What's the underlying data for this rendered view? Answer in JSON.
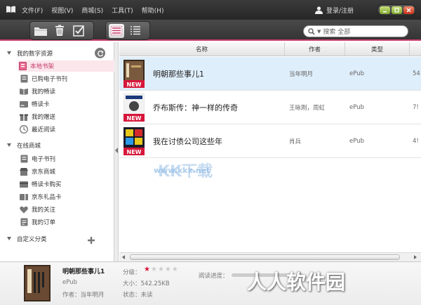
{
  "menu": [
    "文件(F)",
    "视图(V)",
    "商城(S)",
    "工具(T)",
    "帮助(H)"
  ],
  "login_label": "登录/注册",
  "search": {
    "placeholder": "搜索 全部"
  },
  "sidebar": {
    "sections": [
      {
        "title": "我的数字资源",
        "items": [
          "本地书架",
          "已购电子书刊",
          "我的畅读",
          "畅读卡",
          "我的赠送",
          "最近阅读"
        ]
      },
      {
        "title": "在线商城",
        "items": [
          "电子书刊",
          "京东商城",
          "畅读卡购买",
          "京东礼品卡",
          "我的关注",
          "我的订单"
        ]
      },
      {
        "title": "自定义分类",
        "items": []
      }
    ],
    "selected": "本地书架"
  },
  "table": {
    "columns": [
      "名称",
      "作者",
      "类型"
    ],
    "rows": [
      {
        "title": "明朝那些事儿1",
        "author": "当年明月",
        "type": "ePub",
        "size": "54",
        "badge": "NEW"
      },
      {
        "title": "乔布斯传：神一样的传奇",
        "author": "王咏刚，周虹",
        "type": "ePub",
        "size": "7!",
        "badge": "NEW"
      },
      {
        "title": "我在讨债公司这些年",
        "author": "肖兵",
        "type": "ePub",
        "size": "4!",
        "badge": "NEW"
      }
    ],
    "selected_row": 0
  },
  "detail": {
    "title": "明朝那些事儿1",
    "format": "ePub",
    "author_line": "作者：当年明月",
    "rating_label": "分级：",
    "rating": 1,
    "rating_max": 5,
    "size_line": "大小：542.25KB",
    "status_line": "状态：未读",
    "progress_label": "阅读进度：",
    "progress_pct": 0,
    "progress_text": "%"
  },
  "watermarks": {
    "main": "人人软件园",
    "center": "KK下载",
    "url": "www.kkx.net"
  },
  "colors": {
    "accent": "#c43a6a",
    "selected_row": "#dfeefb",
    "titlebar": "#2f2f2f"
  }
}
